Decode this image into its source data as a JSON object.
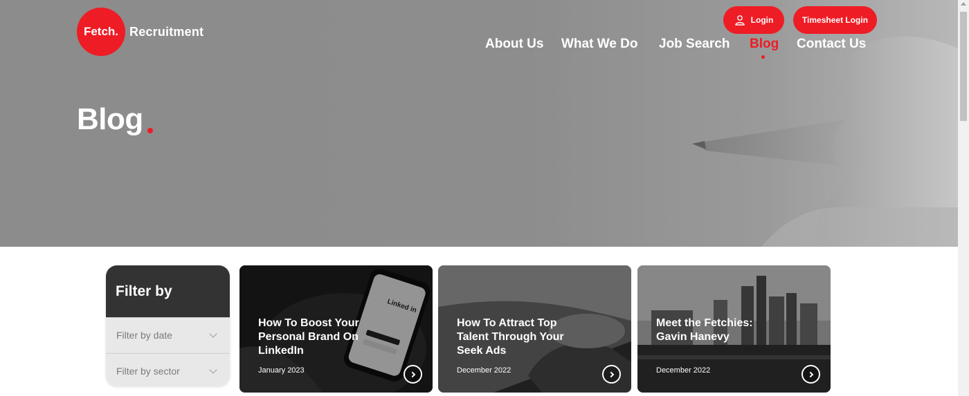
{
  "brand": {
    "logo_text": "Fetch.",
    "logo_word": "Recruitment",
    "accent": "#ee1c25"
  },
  "header": {
    "login_label": "Login",
    "timesheet_label": "Timesheet Login",
    "nav": [
      "About Us",
      "What We Do",
      "Job Search",
      "Blog",
      "Contact Us"
    ],
    "active_nav": "Blog"
  },
  "hero": {
    "title": "Blog"
  },
  "filter": {
    "heading": "Filter by",
    "date_placeholder": "Filter by date",
    "sector_placeholder": "Filter by sector"
  },
  "cards": [
    {
      "title": "How To Boost Your Personal Brand On LinkedIn",
      "date": "January 2023",
      "image_text": "Linked in"
    },
    {
      "title": "How To Attract Top Talent Through Your Seek Ads",
      "date": "December 2022"
    },
    {
      "title": "Meet the Fetchies: Gavin Hanevy",
      "date": "December 2022"
    }
  ]
}
